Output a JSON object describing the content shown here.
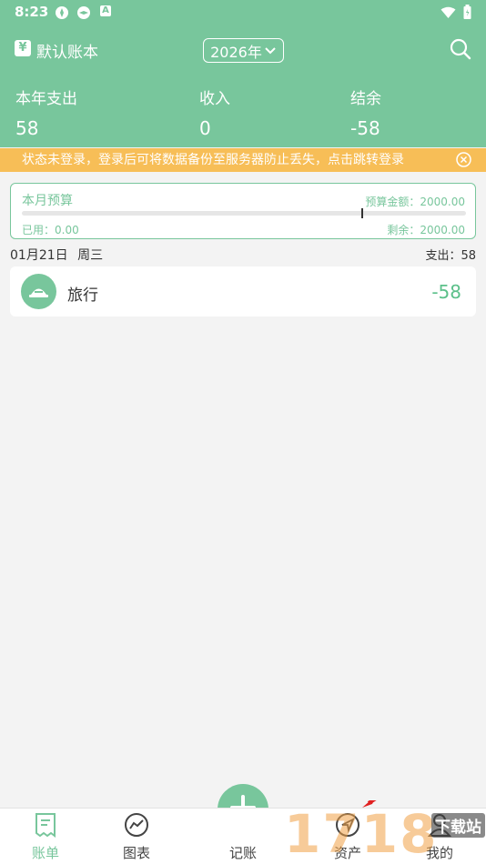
{
  "status_bar": {
    "time": "8:23",
    "notif_badge": "A"
  },
  "topbar": {
    "book_icon_glyph": "¥",
    "book_name": "默认账本",
    "year_label": "2026年"
  },
  "stats": [
    {
      "label": "本年支出",
      "value": "58"
    },
    {
      "label": "收入",
      "value": "0"
    },
    {
      "label": "结余",
      "value": "-58"
    }
  ],
  "notice": {
    "text": "状态未登录，登录后可将数据备份至服务器防止丢失，点击跳转登录"
  },
  "budget": {
    "title": "本月预算",
    "amount_text": "预算金额：2000.00",
    "used_text": "已用：0.00",
    "remain_text": "剩余：2000.00",
    "progress_fraction": 0
  },
  "day": {
    "date": "01月21日",
    "weekday": "周三",
    "summary": "支出：58"
  },
  "records": [
    {
      "category": "旅行",
      "amount": "-58",
      "icon": "travel-hat-icon"
    }
  ],
  "tabs": [
    {
      "label": "账单",
      "icon": "bill-icon",
      "active": true
    },
    {
      "label": "图表",
      "icon": "chart-icon",
      "active": false
    },
    {
      "label": "记账",
      "icon": "plus-icon",
      "active": false
    },
    {
      "label": "资产",
      "icon": "compass-icon",
      "active": false
    },
    {
      "label": "我的",
      "icon": "user-icon",
      "active": false
    }
  ],
  "watermark": {
    "text": "1718",
    "sub": "下载站"
  },
  "colors": {
    "brand": "#78c69c",
    "notice": "#f7be57",
    "amount": "#5cc08a",
    "background": "#f3f3f3"
  }
}
